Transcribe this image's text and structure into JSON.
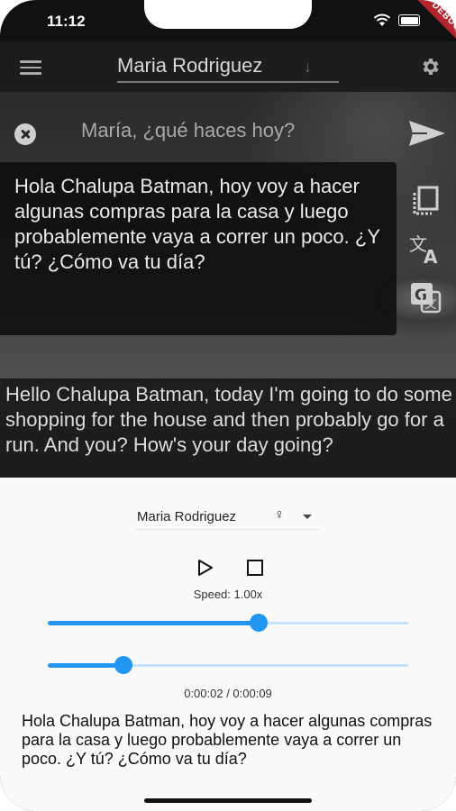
{
  "status_bar": {
    "time": "11:12",
    "debug_banner": "DEBUG"
  },
  "app_bar": {
    "title": "Maria Rodriguez",
    "menu_icon": "menu-icon",
    "settings_icon": "gear-icon"
  },
  "translator": {
    "input_text": "María, ¿qué haces hoy?",
    "source_text": "Hola Chalupa Batman, hoy voy a hacer algunas compras para la casa y luego probablemente vaya a correr un poco. ¿Y tú? ¿Cómo va tu día?",
    "translated_text": "Hello Chalupa Batman, today I'm going to do some shopping for the house and then probably go for a run. And you? How's your day going?",
    "side_icons": [
      "copy-icon",
      "translate-icon",
      "google-translate-icon"
    ]
  },
  "player": {
    "voice_name": "Maria Rodriguez",
    "voice_symbol": "♀",
    "speed_label": "Speed: 1.00x",
    "speed_fraction": 0.585,
    "progress_fraction": 0.21,
    "time_label": "0:00:02 / 0:00:09",
    "current_text": "Hola Chalupa Batman, hoy voy a hacer algunas compras para la casa y luego probablemente vaya a correr un poco. ¿Y tú? ¿Cómo va tu día?"
  },
  "colors": {
    "accent": "#2196f3",
    "accent_track": "#c6e2f7",
    "debug": "#b3262e"
  }
}
